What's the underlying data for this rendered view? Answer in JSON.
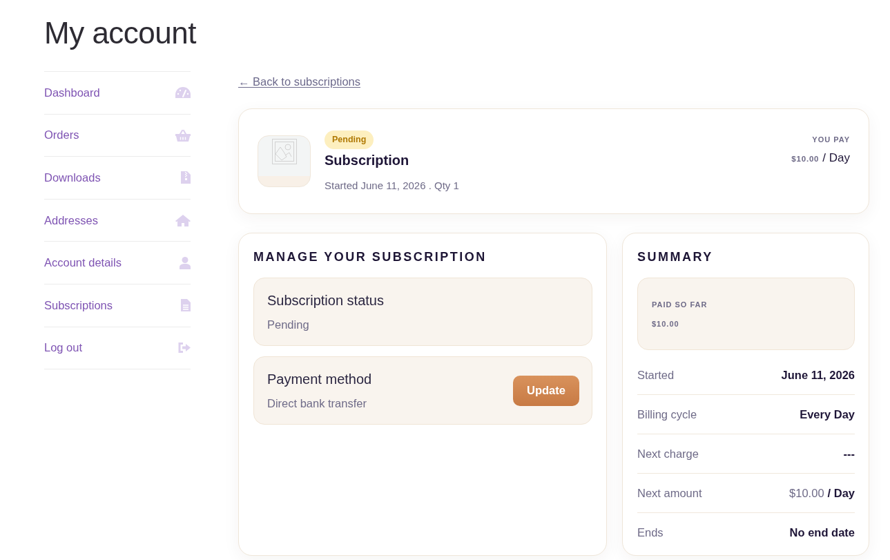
{
  "page": {
    "title": "My account"
  },
  "sidebar": {
    "items": [
      {
        "label": "Dashboard",
        "selected": false
      },
      {
        "label": "Orders",
        "selected": false
      },
      {
        "label": "Downloads",
        "selected": false
      },
      {
        "label": "Addresses",
        "selected": false
      },
      {
        "label": "Account details",
        "selected": false
      },
      {
        "label": "Subscriptions",
        "selected": false
      },
      {
        "label": "Log out",
        "selected": false
      }
    ]
  },
  "back_link": "← Back to subscriptions",
  "subscription": {
    "status": "Pending",
    "name": "Subscription",
    "meta": "Started June 11, 2026 . Qty 1",
    "you_pay_label": "YOU PAY",
    "amount": "$10.00",
    "period": "/ Day"
  },
  "manage": {
    "title": "MANAGE YOUR SUBSCRIPTION",
    "sections": [
      {
        "title": "Subscription status",
        "value": "Pending"
      },
      {
        "title": "Payment method",
        "value": "Direct bank transfer",
        "action": "Update"
      }
    ]
  },
  "summary": {
    "title": "SUMMARY",
    "paid_label": "PAID SO FAR",
    "paid_value": "$10.00",
    "rows": [
      {
        "kind": "text",
        "label": "Started",
        "value": "June 11, 2026"
      },
      {
        "kind": "text",
        "label": "Billing cycle",
        "value": "Every Day"
      },
      {
        "kind": "text",
        "label": "Next charge",
        "value": "---"
      },
      {
        "kind": "price",
        "label": "Next amount",
        "amount": "$10.00",
        "period": "/ Day"
      },
      {
        "kind": "text",
        "label": "Ends",
        "value": "No end date"
      }
    ]
  }
}
